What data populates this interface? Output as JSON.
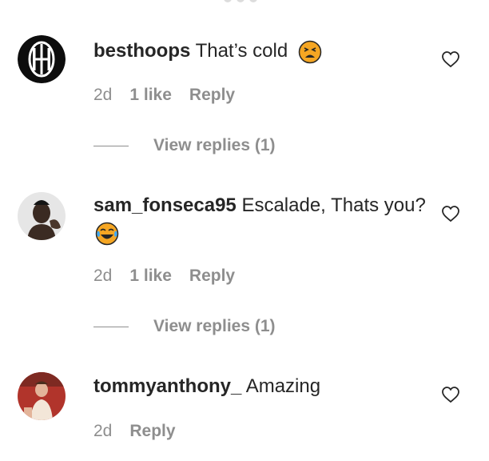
{
  "comments": [
    {
      "username": "besthoops",
      "text": "That’s cold",
      "emoji": "tired-face",
      "time": "2d",
      "likes": "1 like",
      "reply_label": "Reply",
      "view_replies": "View replies (1)"
    },
    {
      "username": "sam_fonseca95",
      "text": "Escalade, Thats you?",
      "emoji": "joy-face",
      "time": "2d",
      "likes": "1 like",
      "reply_label": "Reply",
      "view_replies": "View replies (1)"
    },
    {
      "username": "tommyanthony_",
      "text": "Amazing",
      "time": "2d",
      "reply_label": "Reply"
    }
  ],
  "colors": {
    "primary_text": "#262626",
    "secondary_text": "#8e8e8e",
    "background": "#ffffff"
  }
}
